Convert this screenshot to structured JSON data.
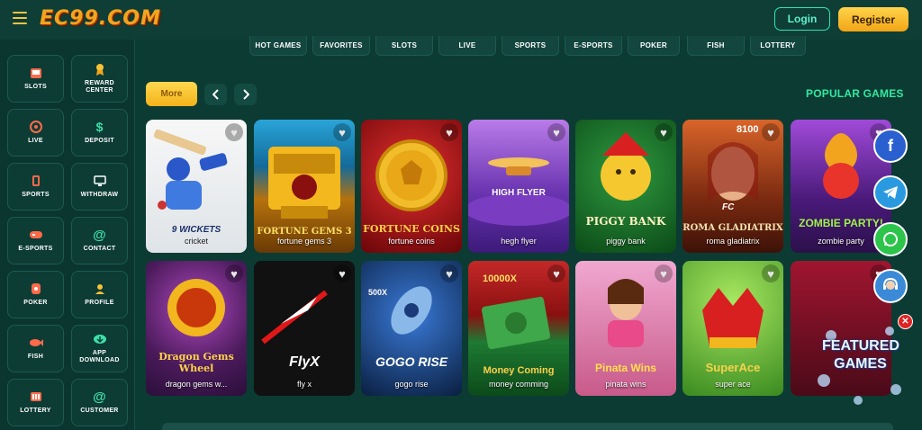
{
  "header": {
    "logo": "EC99.COM",
    "login_label": "Login",
    "register_label": "Register",
    "menu_icon": "hamburger-icon"
  },
  "sidebar": {
    "items": [
      {
        "label": "SLOTS",
        "icon": "slot-machine-icon"
      },
      {
        "label": "REWARD CENTER",
        "icon": "medal-icon"
      },
      {
        "label": "LIVE",
        "icon": "live-icon"
      },
      {
        "label": "DEPOSIT",
        "icon": "dollar-icon"
      },
      {
        "label": "SPORTS",
        "icon": "sports-icon"
      },
      {
        "label": "WITHDRAW",
        "icon": "monitor-icon"
      },
      {
        "label": "E-SPORTS",
        "icon": "gamepad-icon"
      },
      {
        "label": "CONTACT",
        "icon": "at-icon"
      },
      {
        "label": "POKER",
        "icon": "poker-icon"
      },
      {
        "label": "PROFILE",
        "icon": "user-icon"
      },
      {
        "label": "FISH",
        "icon": "fish-icon"
      },
      {
        "label": "APP DOWNLOAD",
        "icon": "download-icon"
      },
      {
        "label": "LOTTERY",
        "icon": "lottery-icon"
      },
      {
        "label": "CUSTOMER",
        "icon": "at-icon"
      }
    ]
  },
  "topnav": {
    "tabs": [
      "HOT GAMES",
      "FAVORITES",
      "SLOTS",
      "LIVE",
      "SPORTS",
      "E-SPORTS",
      "POKER",
      "FISH",
      "LOTTERY"
    ]
  },
  "controls": {
    "more_label": "More",
    "prev_icon": "chevron-left-icon",
    "next_icon": "chevron-right-icon",
    "section_title": "POPULAR GAMES"
  },
  "games": {
    "row1": [
      {
        "name": "cricket",
        "art": "9 WICKETS",
        "color1": "#f3f3f3",
        "color2": "#d7dde3"
      },
      {
        "name": "fortune gems 3",
        "art": "FORTUNE GEMS 3",
        "color1": "#2aa4d8",
        "color2": "#b5720d"
      },
      {
        "name": "fortune coins",
        "art": "FORTUNE COINS",
        "color1": "#c2171a",
        "color2": "#6a0508"
      },
      {
        "name": "hegh flyer",
        "art": "HIGH FLYER",
        "color1": "#9a5ad8",
        "color2": "#3c1a7a"
      },
      {
        "name": "piggy bank",
        "art": "PIGGY BANK",
        "color1": "#1e7a2e",
        "color2": "#0b4a17"
      },
      {
        "name": "roma gladiatrix",
        "art": "ROMA GLADIATRIX",
        "color1": "#b03a1a",
        "color2": "#3d1208"
      },
      {
        "name": "zombie party",
        "art": "ZOMBIE PARTY!",
        "color1": "#7a2cbb",
        "color2": "#2b104a"
      }
    ],
    "row2": [
      {
        "name": "dragon gems w...",
        "art": "Dragon Gems Wheel",
        "color1": "#8a3a9a",
        "color2": "#2a0f3a"
      },
      {
        "name": "fly x",
        "art": "FlyX",
        "color1": "#1a1a1a",
        "color2": "#000000"
      },
      {
        "name": "gogo rise",
        "art": "GOGO RISE",
        "color1": "#1a4e8a",
        "color2": "#0a1f40"
      },
      {
        "name": "money comming",
        "art": "Money Coming",
        "color1": "#c02020",
        "color2": "#1e7a32"
      },
      {
        "name": "pinata wins",
        "art": "Pinata Wins",
        "color1": "#e28bbf",
        "color2": "#b3456f"
      },
      {
        "name": "super ace",
        "art": "SuperAce",
        "color1": "#62b838",
        "color2": "#2a7220"
      },
      {
        "name": "",
        "art": "",
        "color1": "#a01530",
        "color2": "#4a0a18"
      }
    ]
  },
  "labels_extra": {
    "card_badge_8100": "8100",
    "card_badge_10000x": "10000X",
    "card_badge_500x": "500X",
    "card_badge_fc": "FC"
  },
  "floating": {
    "facebook_icon": "facebook-icon",
    "telegram_icon": "telegram-icon",
    "whatsapp_icon": "whatsapp-icon",
    "support_icon": "headset-icon",
    "featured_label": "FEATURED GAMES",
    "close_icon": "close-icon",
    "close_glyph": "✕",
    "facebook_glyph": "f"
  }
}
